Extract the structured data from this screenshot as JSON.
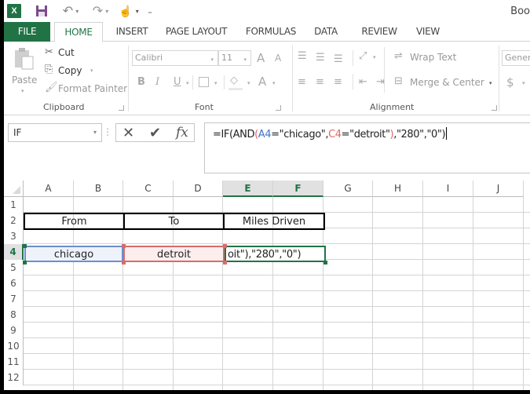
{
  "app": {
    "title": "Boo",
    "quick_access": {
      "excel_icon": "excel-logo-icon",
      "save_icon": "save-icon",
      "undo_icon": "undo-icon",
      "redo_icon": "redo-icon",
      "touch_mode_icon": "touch-mode-icon",
      "customize_icon": "customize-qat-icon"
    }
  },
  "tabs": [
    {
      "label": "FILE"
    },
    {
      "label": "HOME",
      "active": true
    },
    {
      "label": "INSERT"
    },
    {
      "label": "PAGE LAYOUT"
    },
    {
      "label": "FORMULAS"
    },
    {
      "label": "DATA"
    },
    {
      "label": "REVIEW"
    },
    {
      "label": "VIEW"
    }
  ],
  "ribbon": {
    "clipboard": {
      "label": "Clipboard",
      "paste": "Paste",
      "cut": "Cut",
      "copy": "Copy",
      "format_painter": "Format Painter"
    },
    "font": {
      "label": "Font",
      "font_name": "Calibri",
      "font_size": "11",
      "bold": "B",
      "italic": "I",
      "underline": "U",
      "grow": "A",
      "shrink": "A",
      "font_color": "A"
    },
    "alignment": {
      "label": "Alignment",
      "wrap_text": "Wrap Text",
      "merge_center": "Merge & Center"
    },
    "number": {
      "format": "Gener",
      "currency": "$"
    }
  },
  "formula_bar": {
    "name_box": "IF",
    "cancel_icon": "✕",
    "enter_icon": "✔",
    "fx_label": "fx",
    "formula_parts": [
      {
        "text": "=IF(AND",
        "color": "#222222"
      },
      {
        "text": "(",
        "color": "#e06666"
      },
      {
        "text": "A4",
        "color": "#4472c4"
      },
      {
        "text": "=\"chicago\",",
        "color": "#222222"
      },
      {
        "text": "C4",
        "color": "#e06666"
      },
      {
        "text": "=\"detroit\"",
        "color": "#222222"
      },
      {
        "text": ")",
        "color": "#e06666"
      },
      {
        "text": ",\"280\",\"0\")",
        "color": "#222222"
      }
    ]
  },
  "sheet": {
    "columns": [
      "A",
      "B",
      "C",
      "D",
      "E",
      "F",
      "G",
      "H",
      "I",
      "J"
    ],
    "selected_columns": [
      "E",
      "F"
    ],
    "rows": [
      "1",
      "2",
      "3",
      "4",
      "5",
      "6",
      "7",
      "8",
      "9",
      "10",
      "11",
      "12"
    ],
    "selected_row": "4",
    "cells": {
      "A2": "From",
      "C2": "To",
      "E2": "Miles Driven",
      "A4": "chicago",
      "C4": "detroit",
      "E4": "oit\"),\"280\",\"0\")"
    },
    "ref_colors": {
      "A4": "#4472c4",
      "C4": "#e06666",
      "active": "#217346"
    }
  }
}
